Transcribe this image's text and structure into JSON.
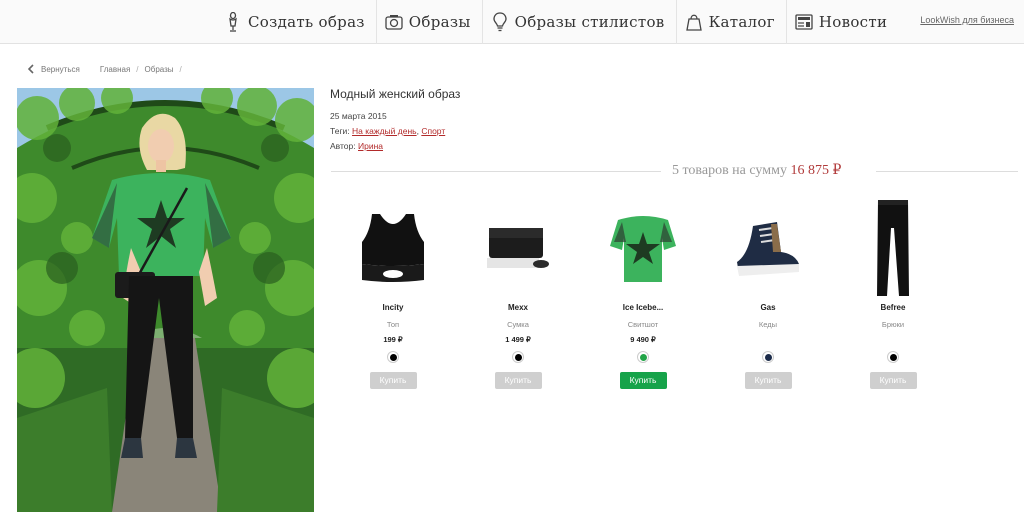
{
  "nav": {
    "items": [
      {
        "label": "Создать образ",
        "icon": "mannequin-icon"
      },
      {
        "label": "Образы",
        "icon": "outfits-icon"
      },
      {
        "label": "Образы стилистов",
        "icon": "lightbulb-icon"
      },
      {
        "label": "Каталог",
        "icon": "shopping-bag-icon"
      },
      {
        "label": "Новости",
        "icon": "news-icon"
      }
    ],
    "business_link": "LookWish для бизнеса"
  },
  "breadcrumb": {
    "back": "Вернуться",
    "items": [
      "Главная",
      "Образы"
    ]
  },
  "outfit": {
    "title": "Модный женский образ",
    "date": "25 марта 2015",
    "tags_label": "Теги:",
    "tags": [
      "На каждый день",
      "Спорт"
    ],
    "author_label": "Автор:",
    "author": "Ирина"
  },
  "summary": {
    "text": "5 товаров на сумму",
    "total": "16 875 ₽"
  },
  "products": [
    {
      "brand": "Incity",
      "type": "Топ",
      "price": "199 ₽",
      "swatch": "#000000",
      "buy": "Купить",
      "active": false,
      "icon": "sports-top-icon"
    },
    {
      "brand": "Mexx",
      "type": "Сумка",
      "price": "1 499 ₽",
      "swatch": "#000000",
      "buy": "Купить",
      "active": false,
      "icon": "bag-icon"
    },
    {
      "brand": "Ice Icebe...",
      "type": "Свитшот",
      "price": "9 490 ₽",
      "swatch": "#22a447",
      "buy": "Купить",
      "active": true,
      "icon": "sweatshirt-icon"
    },
    {
      "brand": "Gas",
      "type": "Кеды",
      "price": "",
      "swatch": "#1c2c4a",
      "buy": "Купить",
      "active": false,
      "icon": "sneaker-icon"
    },
    {
      "brand": "Befree",
      "type": "Брюки",
      "price": "",
      "swatch": "#000000",
      "buy": "Купить",
      "active": false,
      "icon": "leggings-icon"
    }
  ],
  "colors": {
    "accent_red": "#b22a2a",
    "buy_active": "#16a34a",
    "buy_inactive": "#cfcfcf"
  }
}
